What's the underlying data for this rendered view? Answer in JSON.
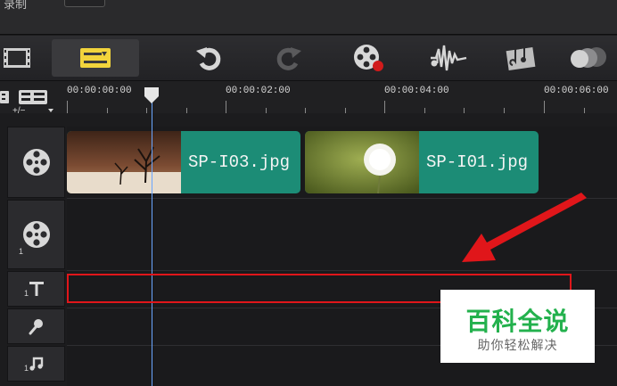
{
  "top": {
    "truncated_label": "录制"
  },
  "toolbar": {
    "buttons": [
      {
        "icon": "filmstrip-view-icon"
      },
      {
        "icon": "timeline-view-icon",
        "active": true
      },
      {
        "icon": "undo-icon"
      },
      {
        "icon": "redo-icon"
      },
      {
        "icon": "record-capture-icon"
      },
      {
        "icon": "sound-mixer-icon"
      },
      {
        "icon": "auto-music-icon"
      },
      {
        "icon": "more-icon"
      }
    ]
  },
  "ruler": {
    "timecodes": [
      "00:00:00:00",
      "00:00:02:00",
      "00:00:04:00",
      "00:00:06:00"
    ]
  },
  "tracks": {
    "video_track_label": "",
    "overlay_track_index": "1",
    "title_track_index": "1",
    "music_track_index": "1"
  },
  "clips": [
    {
      "name": "SP-I03.jpg"
    },
    {
      "name": "SP-I01.jpg"
    }
  ],
  "watermark": {
    "title": "百科全说",
    "subtitle": "助你轻松解决"
  },
  "colors": {
    "clip": "#1c8c76",
    "highlight": "#e0161a",
    "arrow": "#e0161a",
    "playhead": "#6aa6ff",
    "active_icon": "#f2d43c"
  }
}
